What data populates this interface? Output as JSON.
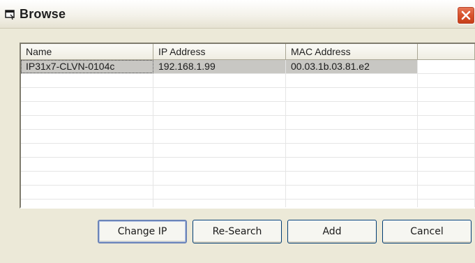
{
  "window": {
    "title": "Browse",
    "icon": "window-icon",
    "close_icon": "close-icon",
    "close_color": "#d8522c"
  },
  "list": {
    "columns": [
      {
        "label": "Name"
      },
      {
        "label": "IP Address"
      },
      {
        "label": "MAC Address"
      },
      {
        "label": ""
      }
    ],
    "rows": [
      {
        "name": "IP31x7-CLVN-0104c",
        "ip": "192.168.1.99",
        "mac": "00.03.1b.03.81.e2",
        "selected": true
      }
    ],
    "selection_color": "#c8c7c3"
  },
  "buttons": {
    "change_ip": "Change IP",
    "re_search": "Re-Search",
    "add": "Add",
    "cancel": "Cancel"
  }
}
